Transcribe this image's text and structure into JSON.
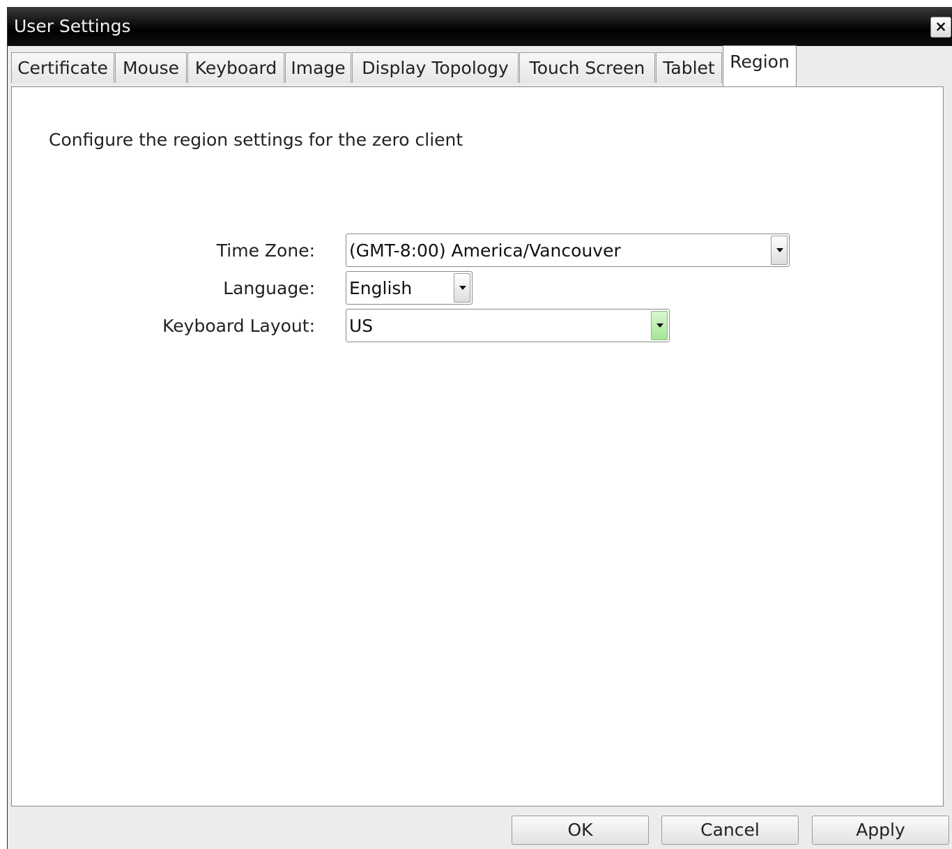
{
  "window": {
    "title": "User Settings",
    "close_glyph": "×"
  },
  "tabs": [
    {
      "label": "Certificate"
    },
    {
      "label": "Mouse"
    },
    {
      "label": "Keyboard"
    },
    {
      "label": "Image"
    },
    {
      "label": "Display Topology"
    },
    {
      "label": "Touch Screen"
    },
    {
      "label": "Tablet"
    },
    {
      "label": "Region"
    }
  ],
  "active_tab": "Region",
  "region": {
    "description": "Configure the region settings for the zero client",
    "time_zone": {
      "label": "Time Zone:",
      "value": "(GMT-8:00) America/Vancouver"
    },
    "language": {
      "label": "Language:",
      "value": "English"
    },
    "keyboard_layout": {
      "label": "Keyboard Layout:",
      "value": "US"
    }
  },
  "buttons": {
    "ok": "OK",
    "cancel": "Cancel",
    "apply": "Apply"
  },
  "icons": {
    "close": "close-icon",
    "dropdown": "chevron-down-icon"
  },
  "colors": {
    "titlebar": "#000000",
    "hover_arrow": "#a6e597"
  }
}
